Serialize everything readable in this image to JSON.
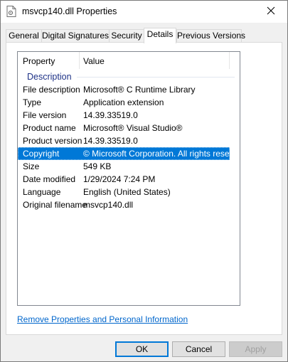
{
  "window": {
    "title": "msvcp140.dll Properties"
  },
  "tabs": [
    {
      "label": "General"
    },
    {
      "label": "Digital Signatures"
    },
    {
      "label": "Security"
    },
    {
      "label": "Details"
    },
    {
      "label": "Previous Versions"
    }
  ],
  "active_tab": "Details",
  "details": {
    "columns": {
      "property": "Property",
      "value": "Value"
    },
    "group": "Description",
    "rows": [
      {
        "property": "File description",
        "value": "Microsoft® C Runtime Library"
      },
      {
        "property": "Type",
        "value": "Application extension"
      },
      {
        "property": "File version",
        "value": "14.39.33519.0"
      },
      {
        "property": "Product name",
        "value": "Microsoft® Visual Studio®"
      },
      {
        "property": "Product version",
        "value": "14.39.33519.0"
      },
      {
        "property": "Copyright",
        "value": "© Microsoft Corporation. All rights reserv..."
      },
      {
        "property": "Size",
        "value": "549 KB"
      },
      {
        "property": "Date modified",
        "value": "1/29/2024 7:24 PM"
      },
      {
        "property": "Language",
        "value": "English (United States)"
      },
      {
        "property": "Original filename",
        "value": "msvcp140.dll"
      }
    ],
    "selected_row": "Copyright"
  },
  "link": {
    "label": "Remove Properties and Personal Information"
  },
  "buttons": {
    "ok": "OK",
    "cancel": "Cancel",
    "apply": "Apply"
  },
  "colors": {
    "selection": "#0078d7",
    "group_label": "#1e3287",
    "link": "#0066cc"
  },
  "icons": {
    "title": "dll-file-icon",
    "close": "close-icon"
  }
}
